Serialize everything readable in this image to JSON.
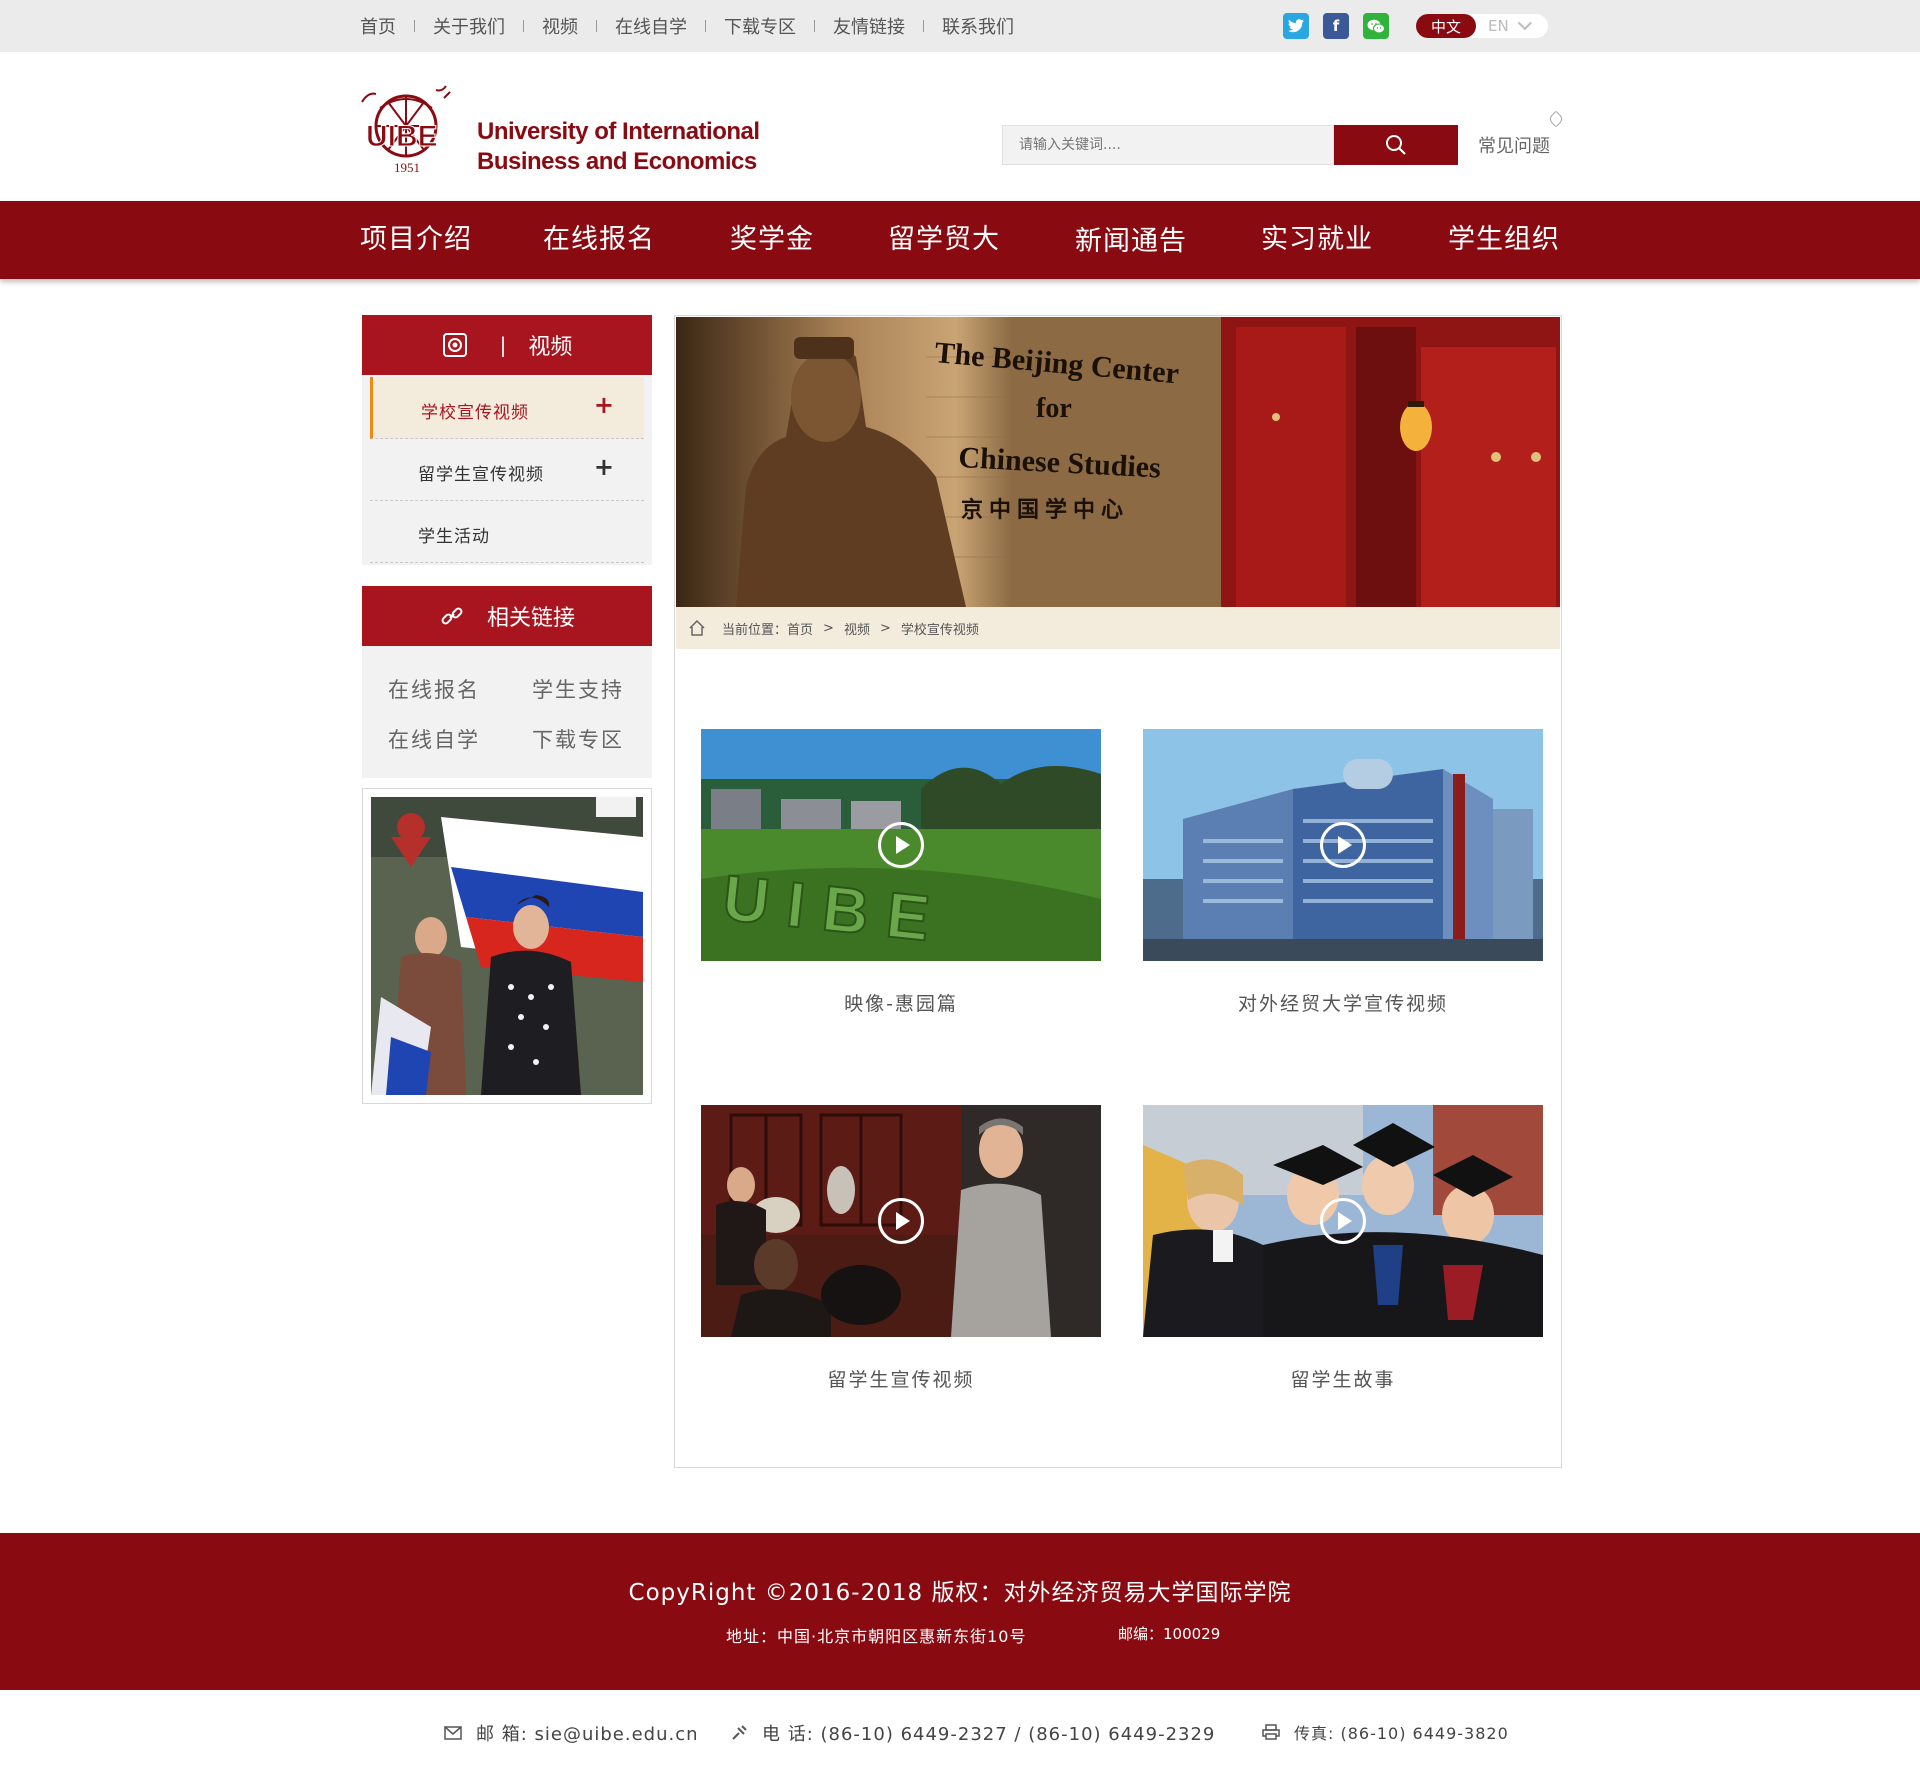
{
  "topnav": {
    "links": [
      "首页",
      "关于我们",
      "视频",
      "在线自学",
      "下载专区",
      "友情链接",
      "联系我们"
    ],
    "lang_active": "中文",
    "lang_other": "EN"
  },
  "header": {
    "logo_line1": "University of International",
    "logo_line2": "Business and Economics",
    "logo_year": "1951",
    "search_placeholder": "请输入关键词....",
    "faq": "常见问题"
  },
  "mainnav": [
    "项目介绍",
    "在线报名",
    "奖学金",
    "留学贸大",
    "新闻通告",
    "实习就业",
    "学生组织"
  ],
  "sidebar": {
    "title": "视频",
    "items": [
      {
        "label": "学校宣传视频",
        "expandable": true,
        "active": true
      },
      {
        "label": "留学生宣传视频",
        "expandable": true,
        "active": false
      },
      {
        "label": "学生活动",
        "expandable": false,
        "active": false
      }
    ],
    "links_title": "相关链接",
    "links": [
      "在线报名",
      "学生支持",
      "在线自学",
      "下载专区"
    ]
  },
  "banner": {
    "sign_line1": "The Beijing Center",
    "sign_line2": "for",
    "sign_line3": "Chinese Studies",
    "sign_cn": "京中国学中心"
  },
  "breadcrumb": {
    "prefix": "当前位置：",
    "items": [
      "首页",
      "视频",
      "学校宣传视频"
    ],
    "separator": ">"
  },
  "videos": [
    {
      "title": "映像-惠园篇"
    },
    {
      "title": "对外经贸大学宣传视频"
    },
    {
      "title": "留学生宣传视频"
    },
    {
      "title": "留学生故事"
    }
  ],
  "footer": {
    "copyright": "CopyRight ©2016-2018 版权：对外经济贸易大学国际学院",
    "address": "地址：中国·北京市朝阳区惠新东街10号",
    "zip": "邮编：100029",
    "email": "邮 箱: sie@uibe.edu.cn",
    "phone": "电 话: (86-10) 6449-2327 / (86-10) 6449-2329",
    "fax": "传真: (86-10) 6449-3820"
  },
  "colors": {
    "brand": "#8a0a12",
    "sidebar_header": "#a8151f",
    "active_accent": "#ef8b14",
    "breadcrumb_bg": "#f3ecdd"
  }
}
